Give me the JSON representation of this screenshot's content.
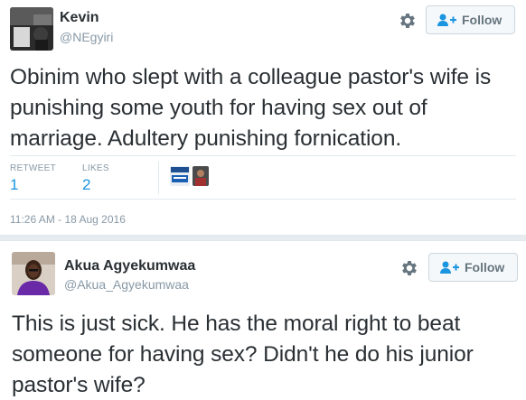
{
  "tweets": [
    {
      "author_name": "Kevin",
      "author_handle": "@NEgyiri",
      "follow_label": "Follow",
      "text": "Obinim who slept with a colleague pastor's wife is punishing some youth for having sex out of marriage.  Adultery punishing fornication.",
      "retweets_label": "RETWEET",
      "retweets_count": "1",
      "likes_label": "LIKES",
      "likes_count": "2",
      "timestamp": "11:26 AM - 18 Aug 2016"
    },
    {
      "author_name": "Akua Agyekumwaa",
      "author_handle": "@Akua_Agyekumwaa",
      "follow_label": "Follow",
      "text": "This is just sick. He has the moral right to beat someone for having sex? Didn't he do his junior pastor's wife?"
    }
  ],
  "colors": {
    "link_blue": "#1b95e0",
    "muted_gray": "#8899a6",
    "text_dark": "#292f33"
  },
  "icons": [
    "gear-icon",
    "follow-person-plus-icon"
  ]
}
